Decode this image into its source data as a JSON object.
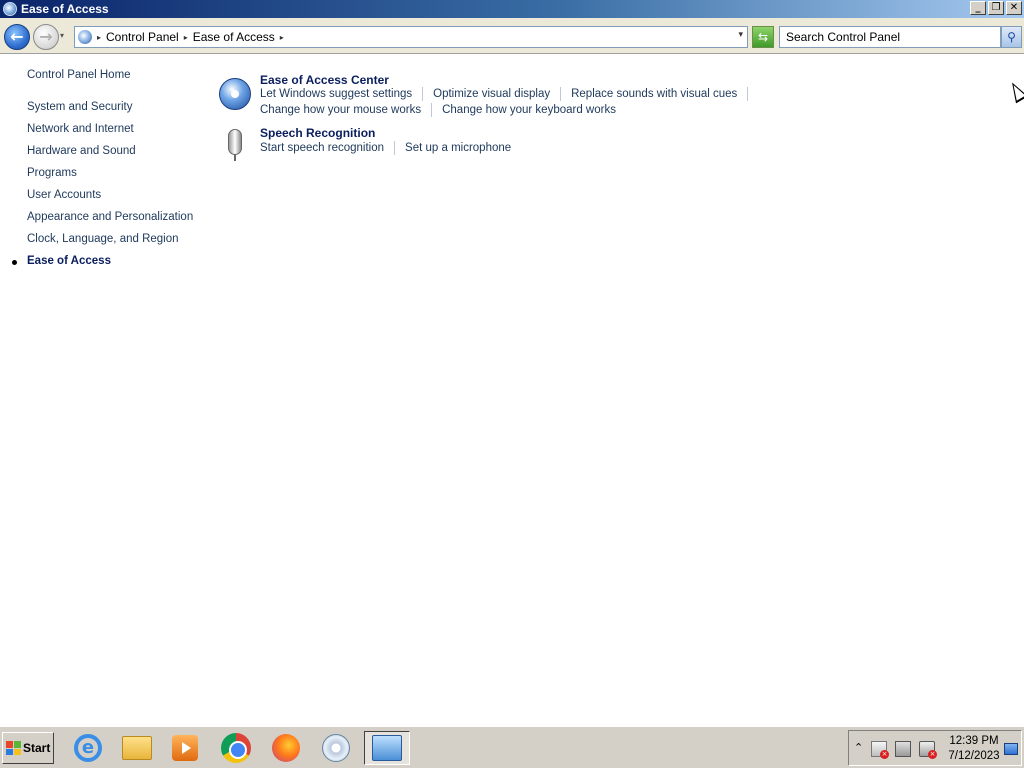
{
  "window": {
    "title": "Ease of Access",
    "minimize_label": "_",
    "restore_label": "❐",
    "close_label": "✕"
  },
  "nav": {
    "back_label": "←",
    "forward_label": "→",
    "history_dropdown": "▾",
    "breadcrumb": [
      "Control Panel",
      "Ease of Access"
    ],
    "breadcrumb_separator": "▸",
    "address_dropdown": "▾",
    "refresh_label": "⇆",
    "search_placeholder": "Search Control Panel",
    "search_icon": "search-icon",
    "search_glyph": "⚲"
  },
  "leftnav": {
    "items": [
      "Control Panel Home",
      "System and Security",
      "Network and Internet",
      "Hardware and Sound",
      "Programs",
      "User Accounts",
      "Appearance and Personalization",
      "Clock, Language, and Region",
      "Ease of Access"
    ],
    "current": "Ease of Access"
  },
  "categories": [
    {
      "title": "Ease of Access Center",
      "icon": "ease-of-access-icon",
      "links_row1": [
        "Let Windows suggest settings",
        "Optimize visual display",
        "Replace sounds with visual cues"
      ],
      "links_row2": [
        "Change how your mouse works",
        "Change how your keyboard works"
      ]
    },
    {
      "title": "Speech Recognition",
      "icon": "microphone-icon",
      "links_row1": [
        "Start speech recognition",
        "Set up a microphone"
      ]
    }
  ],
  "taskbar": {
    "start_label": "Start",
    "start_flag_colors": [
      "#e8452c",
      "#5bb536",
      "#2a7ae0",
      "#f6c21a"
    ],
    "apps": [
      "internet-explorer-icon",
      "windows-explorer-icon",
      "media-player-icon",
      "chrome-icon",
      "firefox-icon",
      "disc-burner-icon",
      "control-panel-icon"
    ],
    "ie_glyph": "e",
    "tray_chevron": "⌃",
    "tray_badge_glyph": "×",
    "clock_time": "12:39 PM",
    "clock_date": "7/12/2023"
  },
  "colors": {
    "link": "#1e395b",
    "title_bar_start": "#0a246a",
    "title_bar_end": "#a6caf0"
  }
}
